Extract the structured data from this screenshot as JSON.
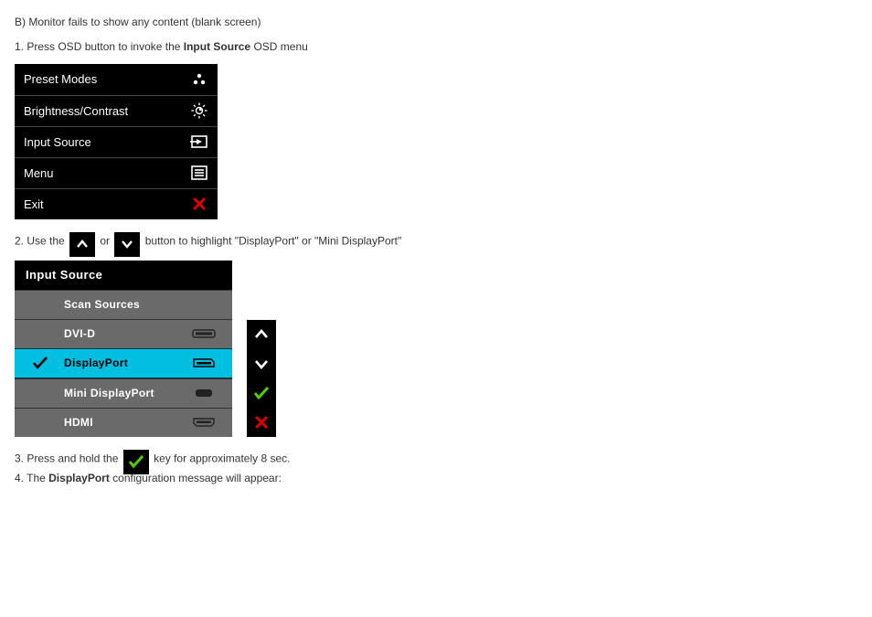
{
  "intro": {
    "heading": "B) Monitor fails to show any content (blank screen)",
    "step1_a": "1. Press OSD button to invoke the ",
    "step1_bold": "Input Source",
    "step1_b": " OSD menu"
  },
  "osd1": {
    "items": [
      {
        "label": "Preset Modes",
        "icon": "dots"
      },
      {
        "label": "Brightness/Contrast",
        "icon": "brightness"
      },
      {
        "label": "Input Source",
        "icon": "input"
      },
      {
        "label": "Menu",
        "icon": "menu"
      },
      {
        "label": "Exit",
        "icon": "close"
      }
    ]
  },
  "step2": {
    "a": "2. Use the ",
    "or": " or ",
    "b": " button to highlight \"DisplayPort\" or \"Mini DisplayPort\""
  },
  "osd2": {
    "header": "Input Source",
    "rows": [
      {
        "label": "Scan Sources",
        "port": "",
        "selected": false
      },
      {
        "label": "DVI-D",
        "port": "dvi",
        "selected": false
      },
      {
        "label": "DisplayPort",
        "port": "dp",
        "selected": true
      },
      {
        "label": "Mini DisplayPort",
        "port": "mdp",
        "selected": false
      },
      {
        "label": "HDMI",
        "port": "hdmi",
        "selected": false
      }
    ],
    "side": [
      "up",
      "down",
      "ok",
      "close"
    ]
  },
  "step3": {
    "a": "3. Press and hold the ",
    "b": " key for approximately 8 sec."
  },
  "step4": {
    "a": "4. The ",
    "bold": "DisplayPort",
    "b": " configuration message will appear:"
  }
}
